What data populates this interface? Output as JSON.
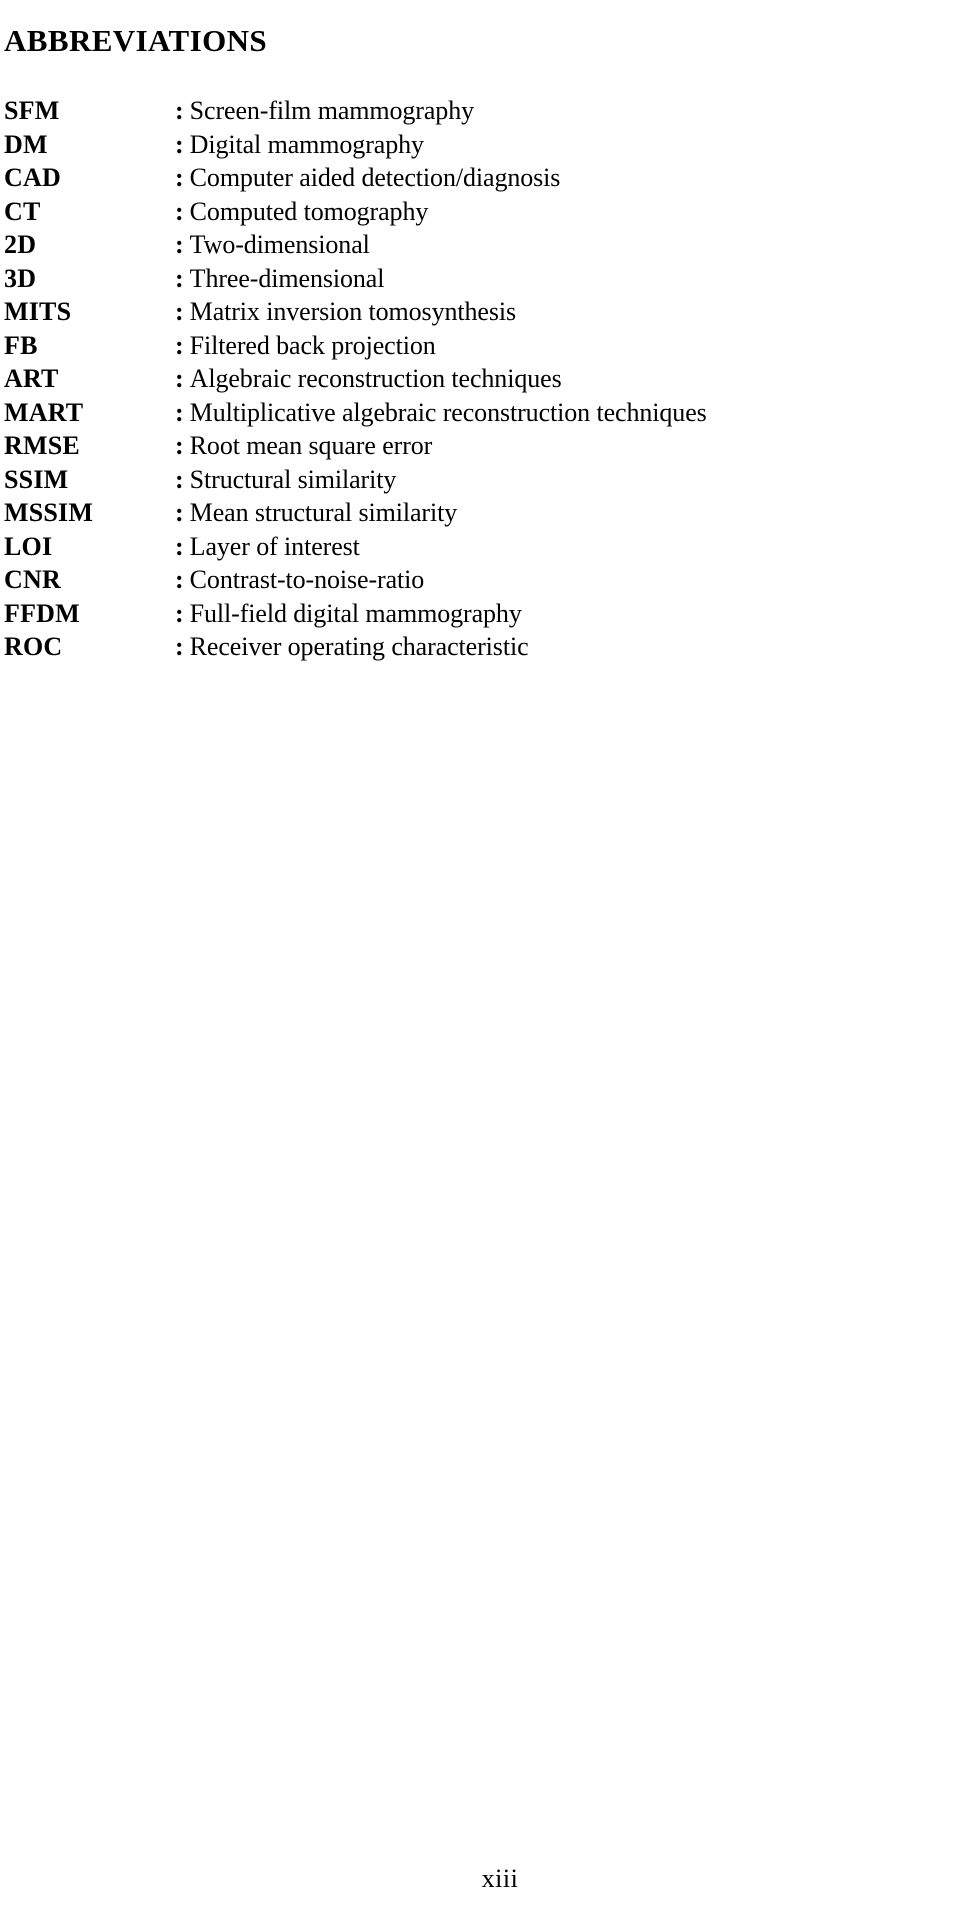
{
  "document": {
    "heading": "ABBREVIATIONS",
    "page_number": "xiii",
    "separator": ":"
  },
  "abbreviations": [
    {
      "term": "SFM",
      "definition": "Screen-film mammography"
    },
    {
      "term": "DM",
      "definition": "Digital mammography"
    },
    {
      "term": "CAD",
      "definition": "Computer aided detection/diagnosis"
    },
    {
      "term": "CT",
      "definition": "Computed tomography"
    },
    {
      "term": "2D",
      "definition": "Two-dimensional"
    },
    {
      "term": "3D",
      "definition": "Three-dimensional"
    },
    {
      "term": "MITS",
      "definition": "Matrix inversion tomosynthesis"
    },
    {
      "term": "FB",
      "definition": "Filtered back projection"
    },
    {
      "term": "ART",
      "definition": "Algebraic reconstruction techniques"
    },
    {
      "term": "MART",
      "definition": "Multiplicative algebraic reconstruction techniques"
    },
    {
      "term": "RMSE",
      "definition": "Root mean square error"
    },
    {
      "term": "SSIM",
      "definition": "Structural similarity"
    },
    {
      "term": "MSSIM",
      "definition": "Mean structural similarity"
    },
    {
      "term": "LOI",
      "definition": "Layer of interest"
    },
    {
      "term": "CNR",
      "definition": "Contrast-to-noise-ratio"
    },
    {
      "term": "FFDM",
      "definition": "Full-field digital mammography"
    },
    {
      "term": "ROC",
      "definition": "Receiver operating characteristic"
    }
  ]
}
